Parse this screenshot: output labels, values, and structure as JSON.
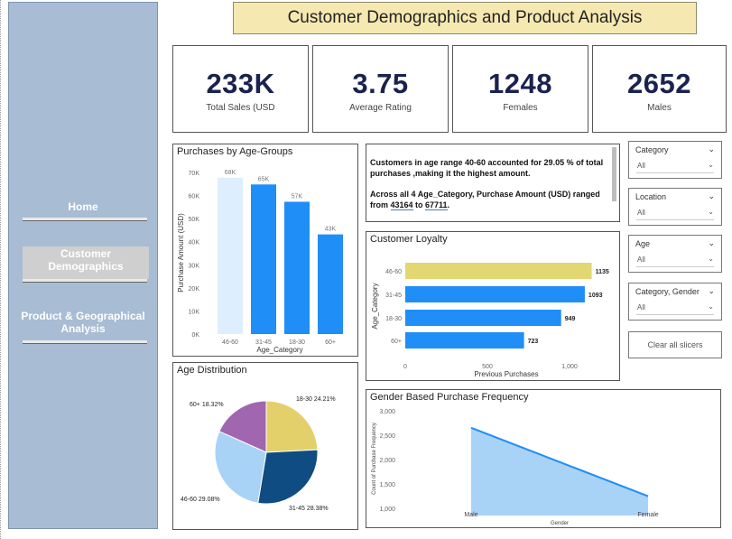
{
  "page_title": "Customer Demographics and Product Analysis",
  "nav": {
    "home": "Home",
    "customer": "Customer Demographics",
    "product": "Product & Geographical Analysis"
  },
  "kpis": [
    {
      "value": "233K",
      "label": "Total Sales (USD"
    },
    {
      "value": "3.75",
      "label": "Average Rating"
    },
    {
      "value": "1248",
      "label": "Females"
    },
    {
      "value": "2652",
      "label": "Males"
    }
  ],
  "insight": {
    "line1": "Customers in age range 40-60 accounted for 29.05 % of total purchases ,making it the highest amount.",
    "line2_prefix": "Across all 4 Age_Category, Purchase Amount (USD) ranged from ",
    "low": "43164",
    "to": " to ",
    "high": "67711",
    "end": "."
  },
  "slicers": [
    {
      "title": "Category",
      "value": "All"
    },
    {
      "title": "Location",
      "value": "All"
    },
    {
      "title": "Age",
      "value": "All"
    },
    {
      "title": "Category, Gender",
      "value": "All"
    }
  ],
  "clear_button": "Clear all slicers",
  "colors": {
    "sidebar": "#a8bcd3",
    "title_bg": "#f5e9b1",
    "bar_blue": "#1f8ef7",
    "bar_light": "#ddeeff",
    "highlight": "#e3d773",
    "kpi_text": "#1b2250"
  },
  "chart_data": [
    {
      "type": "bar",
      "title": "Purchases by Age-Groups",
      "xlabel": "Age_Category",
      "ylabel": "Purchase Amount (USD)",
      "categories": [
        "46-60",
        "31-45",
        "18-30",
        "60+"
      ],
      "values": [
        67711,
        64800,
        57300,
        43164
      ],
      "data_labels": [
        "68K",
        "65K",
        "57K",
        "43K"
      ],
      "yticks": [
        "0K",
        "10K",
        "20K",
        "30K",
        "40K",
        "50K",
        "60K",
        "70K"
      ],
      "ylim": [
        0,
        70000
      ]
    },
    {
      "type": "bar",
      "orientation": "horizontal",
      "title": "Customer Loyalty",
      "xlabel": "Previous Purchases",
      "ylabel": "Age_Category",
      "categories": [
        "46-60",
        "31-45",
        "18-30",
        "60+"
      ],
      "values": [
        1135,
        1093,
        949,
        723
      ],
      "xticks": [
        "0",
        "500",
        "1,000"
      ],
      "xlim": [
        0,
        1150
      ]
    },
    {
      "type": "pie",
      "title": "Age Distribution",
      "slices": [
        {
          "label": "18-30 24.21%",
          "value": 24.21,
          "color": "#e3d06a"
        },
        {
          "label": "31-45 28.38%",
          "value": 28.38,
          "color": "#0f4c81"
        },
        {
          "label": "46-60 29.08%",
          "value": 29.08,
          "color": "#a9d2f7"
        },
        {
          "label": "60+ 18.32%",
          "value": 18.32,
          "color": "#a066b0"
        }
      ]
    },
    {
      "type": "area",
      "title": "Gender Based Purchase Frequency",
      "xlabel": "Gender",
      "ylabel": "Count of Purchase Frequency",
      "categories": [
        "Male",
        "Female"
      ],
      "values": [
        2652,
        1248
      ],
      "yticks": [
        "1,000",
        "1,500",
        "2,000",
        "2,500",
        "3,000"
      ],
      "ylim": [
        1000,
        3000
      ]
    }
  ]
}
